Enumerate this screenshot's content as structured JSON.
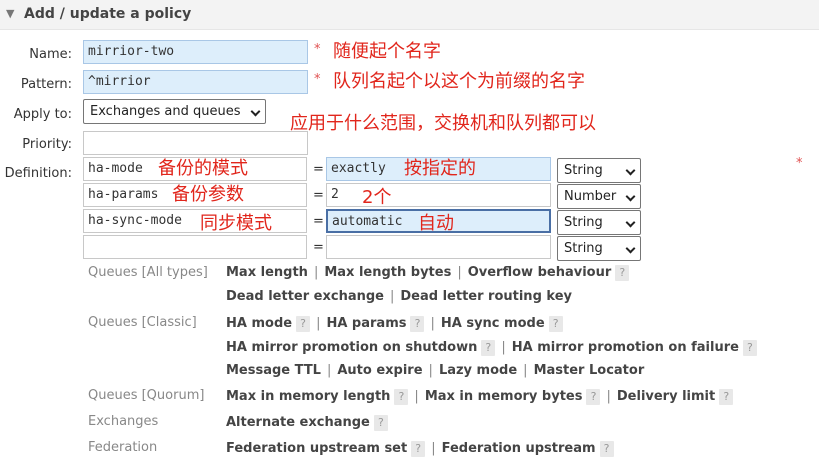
{
  "header": {
    "title": "Add / update a policy",
    "toggle_icon": "triangle-down-icon"
  },
  "form": {
    "name_label": "Name:",
    "name_value": "mirrior-two",
    "name_star": "*",
    "name_note": "随便起个名字",
    "pattern_label": "Pattern:",
    "pattern_value": "^mirrior",
    "pattern_star": "*",
    "pattern_note": "队列名起个以这个为前缀的名字",
    "apply_label": "Apply to:",
    "apply_value": "Exchanges and queues",
    "apply_note": "应用于什么范围，交换机和队列都可以",
    "priority_label": "Priority:",
    "priority_value": "",
    "definition_label": "Definition:",
    "definition_star": "*",
    "definition_rows": [
      {
        "key": "ha-mode",
        "key_note": "备份的模式",
        "eq": "=",
        "value": "exactly",
        "value_note": "按指定的",
        "type": "String"
      },
      {
        "key": "ha-params",
        "key_note": "备份参数",
        "eq": "=",
        "value": "2",
        "value_note": "2个",
        "type": "Number"
      },
      {
        "key": "ha-sync-mode",
        "key_note": "同步模式",
        "eq": "=",
        "value": "automatic",
        "value_note": "自动",
        "type": "String"
      },
      {
        "key": "",
        "key_note": "",
        "eq": "=",
        "value": "",
        "value_note": "",
        "type": "String"
      }
    ]
  },
  "help": {
    "sep": "|",
    "q": "?",
    "queues_all": {
      "label": "Queues [All types]",
      "line1": [
        "Max length",
        "Max length bytes",
        "Overflow behaviour"
      ],
      "line2": [
        "Dead letter exchange",
        "Dead letter routing key"
      ]
    },
    "queues_classic": {
      "label": "Queues [Classic]",
      "line1": [
        "HA mode",
        "HA params",
        "HA sync mode"
      ],
      "line2": [
        "HA mirror promotion on shutdown",
        "HA mirror promotion on failure"
      ],
      "line3": [
        "Message TTL",
        "Auto expire",
        "Lazy mode",
        "Master Locator"
      ]
    },
    "queues_quorum": {
      "label": "Queues [Quorum]",
      "line1": [
        "Max in memory length",
        "Max in memory bytes",
        "Delivery limit"
      ]
    },
    "exchanges": {
      "label": "Exchanges",
      "line1": [
        "Alternate exchange"
      ]
    },
    "federation": {
      "label": "Federation",
      "line1": [
        "Federation upstream set",
        "Federation upstream"
      ]
    }
  }
}
